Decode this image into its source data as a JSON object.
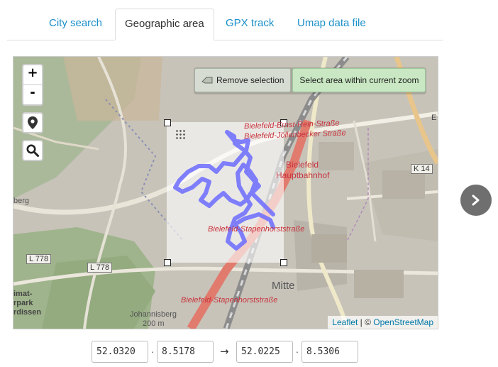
{
  "tabs": [
    {
      "label": "City search"
    },
    {
      "label": "Geographic area"
    },
    {
      "label": "GPX track"
    },
    {
      "label": "Umap data file"
    }
  ],
  "active_tab": "Geographic area",
  "map": {
    "zoom_in": "+",
    "zoom_out": "-",
    "remove_selection": "Remove selection",
    "select_area": "Select area within current zoom",
    "attribution_leaflet": "Leaflet",
    "attribution_sep": " | © ",
    "attribution_osm": "OpenStreetMap",
    "labels": {
      "street_ernst_rein": "Bielefeld-Ernst-Rein-Straße",
      "street_joellenbecker": "Bielefeld-Jöllenbecker Straße",
      "station_bielefeld": "Bielefeld",
      "station_hbf": "Hauptbahnhof",
      "street_stapenhorst": "Bielefeld-Stapenhorststraße",
      "street_stapenhorst_2": "Bielefeld-Stapenhorststraße",
      "road_k14": "K 14",
      "road_l778_a": "L 778",
      "road_l778_b": "L 778",
      "district_mitte": "Mitte",
      "place_johannisberg": "Johannisberg",
      "elevation": "200 m",
      "edge_berg": "berg",
      "edge_imat": "imat-",
      "edge_park": "rpark",
      "edge_rdissen": "rdissen",
      "edge_e": "E"
    }
  },
  "coords": {
    "lat1": "52.0320",
    "lon1": "8.5178",
    "lat2": "52.0225",
    "lon2": "8.5306",
    "sep": ".",
    "arrow": "→"
  },
  "colors": {
    "link": "#1a8fc9",
    "track": "#6b6bff",
    "selection_button": "#c8e7c2"
  },
  "icons": {
    "locate": "map-marker-icon",
    "search": "magnifier-icon",
    "remove": "eraser-icon",
    "next": "chevron-right-icon"
  }
}
